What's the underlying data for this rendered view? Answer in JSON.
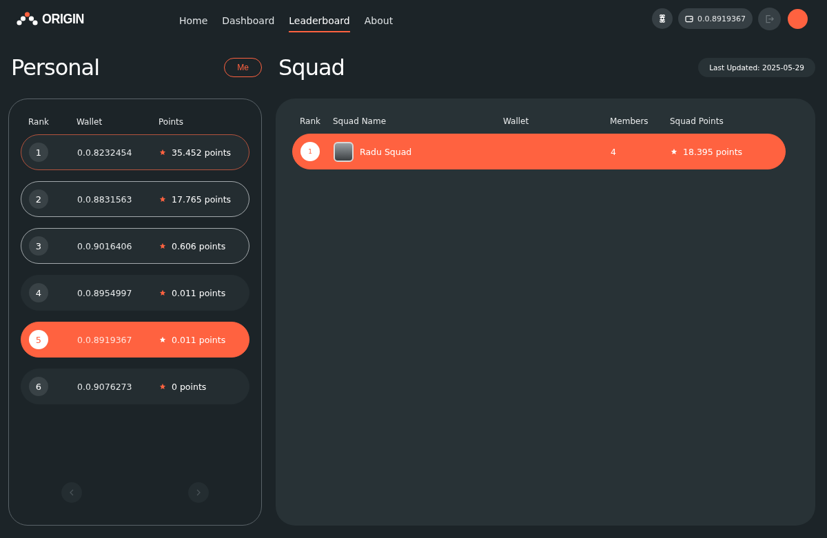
{
  "logo": {
    "text": "ORIGIN"
  },
  "nav": [
    {
      "label": "Home",
      "selected": false
    },
    {
      "label": "Dashboard",
      "selected": false
    },
    {
      "label": "Leaderboard",
      "selected": true
    },
    {
      "label": "About",
      "selected": false
    }
  ],
  "wallet": {
    "address": "0.0.8919367"
  },
  "personal": {
    "title": "Personal",
    "me_button": "Me",
    "columns": [
      "Rank",
      "Wallet",
      "Points"
    ],
    "rows": [
      {
        "rank": "1",
        "wallet": "0.0.8232454",
        "points": "35.452 points",
        "kind": "first",
        "selected": false
      },
      {
        "rank": "2",
        "wallet": "0.0.8831563",
        "points": "17.765 points",
        "kind": "podium",
        "selected": false
      },
      {
        "rank": "3",
        "wallet": "0.0.9016406",
        "points": "0.606 points",
        "kind": "podium",
        "selected": false
      },
      {
        "rank": "4",
        "wallet": "0.0.8954997",
        "points": "0.011 points",
        "kind": "plain",
        "selected": false
      },
      {
        "rank": "5",
        "wallet": "0.0.8919367",
        "points": "0.011 points",
        "kind": "plain",
        "selected": true
      },
      {
        "rank": "6",
        "wallet": "0.0.9076273",
        "points": "0 points",
        "kind": "plain",
        "selected": false
      }
    ]
  },
  "squad": {
    "title": "Squad",
    "last_updated": "Last Updated: 2025-05-29",
    "columns": [
      "Rank",
      "Squad Name",
      "Wallet",
      "Members",
      "Squad Points"
    ],
    "rows": [
      {
        "rank": "1",
        "name": "Radu Squad",
        "members": "4",
        "points": "18.395 points",
        "selected": true
      }
    ]
  }
}
